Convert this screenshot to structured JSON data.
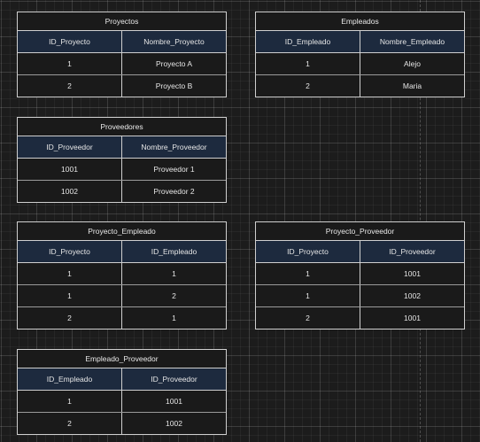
{
  "tables": [
    {
      "title": "Proyectos",
      "columns": [
        "ID_Proyecto",
        "Nombre_Proyecto"
      ],
      "rows": [
        [
          "1",
          "Proyecto A"
        ],
        [
          "2",
          "Proyecto B"
        ]
      ]
    },
    {
      "title": "Empleados",
      "columns": [
        "ID_Empleado",
        "Nombre_Empleado"
      ],
      "rows": [
        [
          "1",
          "Alejo"
        ],
        [
          "2",
          "Maria"
        ]
      ]
    },
    {
      "title": "Proveedores",
      "columns": [
        "ID_Proveedor",
        "Nombre_Proveedor"
      ],
      "rows": [
        [
          "1001",
          "Proveedor 1"
        ],
        [
          "1002",
          "Proveedor 2"
        ]
      ]
    },
    {
      "title": "Proyecto_Empleado",
      "columns": [
        "ID_Proyecto",
        "ID_Empleado"
      ],
      "rows": [
        [
          "1",
          "1"
        ],
        [
          "1",
          "2"
        ],
        [
          "2",
          "1"
        ]
      ]
    },
    {
      "title": "Proyecto_Proveedor",
      "columns": [
        "ID_Proyecto",
        "ID_Proveedor"
      ],
      "rows": [
        [
          "1",
          "1001"
        ],
        [
          "1",
          "1002"
        ],
        [
          "2",
          "1001"
        ]
      ]
    },
    {
      "title": "Empleado_Proveedor",
      "columns": [
        "ID_Empleado",
        "ID_Proveedor"
      ],
      "rows": [
        [
          "1",
          "1001"
        ],
        [
          "2",
          "1002"
        ]
      ]
    }
  ]
}
